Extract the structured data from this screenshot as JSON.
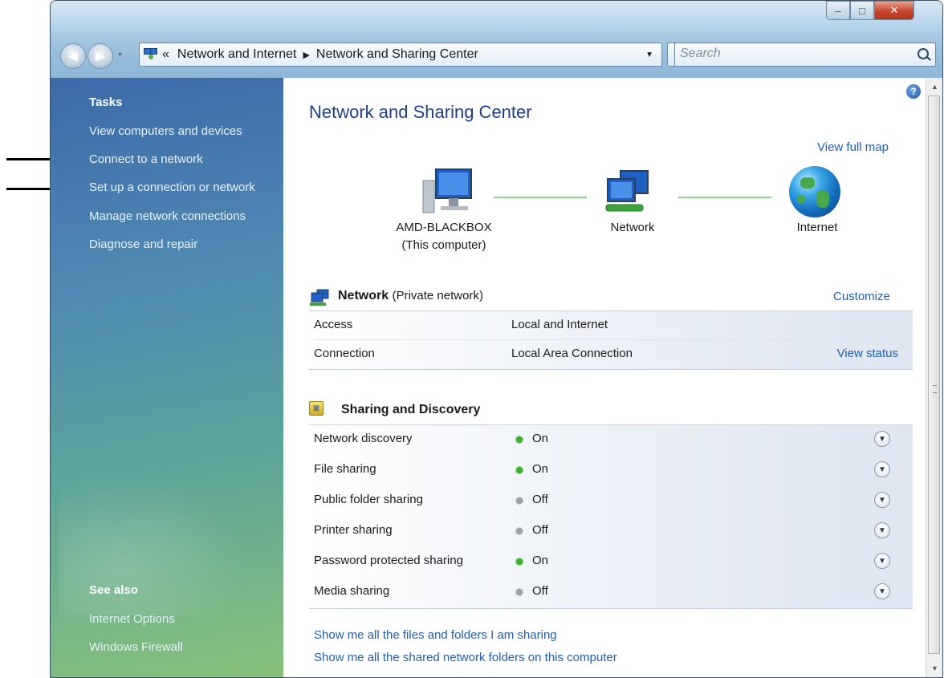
{
  "window": {
    "breadcrumb": [
      "Network and Internet",
      "Network and Sharing Center"
    ],
    "breadcrumb_prefix": "«",
    "search_placeholder": "Search"
  },
  "sidebar": {
    "tasks_heading": "Tasks",
    "tasks": [
      "View computers and devices",
      "Connect to a network",
      "Set up a connection or network",
      "Manage network connections",
      "Diagnose and repair"
    ],
    "see_also_heading": "See also",
    "see_also": [
      "Internet Options",
      "Windows Firewall"
    ]
  },
  "main": {
    "title": "Network and Sharing Center",
    "view_full_map": "View full map",
    "nodes": {
      "computer": "AMD-BLACKBOX\n(This computer)",
      "network": "Network",
      "internet": "Internet"
    },
    "network_section": {
      "name": "Network",
      "type": "(Private network)",
      "customize": "Customize",
      "rows": [
        {
          "key": "Access",
          "value": "Local and Internet",
          "action": ""
        },
        {
          "key": "Connection",
          "value": "Local Area Connection",
          "action": "View status"
        }
      ]
    },
    "sharing_section": {
      "title": "Sharing and Discovery",
      "items": [
        {
          "label": "Network discovery",
          "state": "On"
        },
        {
          "label": "File sharing",
          "state": "On"
        },
        {
          "label": "Public folder sharing",
          "state": "Off"
        },
        {
          "label": "Printer sharing",
          "state": "Off"
        },
        {
          "label": "Password protected sharing",
          "state": "On"
        },
        {
          "label": "Media sharing",
          "state": "Off"
        }
      ]
    },
    "bottom_links": [
      "Show me all the files and folders I am sharing",
      "Show me all the shared network folders on this computer"
    ]
  },
  "colors": {
    "link": "#1e5fb4",
    "title": "#1e3e86",
    "on": "#3db12c",
    "off": "#9aa1a7"
  }
}
